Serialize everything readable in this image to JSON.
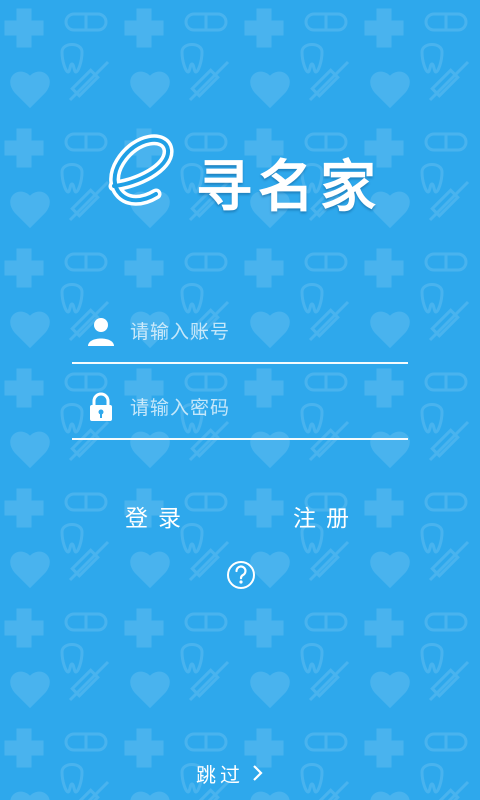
{
  "brand": {
    "letter": "e",
    "name": "寻名家"
  },
  "login_form": {
    "account_placeholder": "请输入账号",
    "password_placeholder": "请输入密码",
    "account_value": "",
    "password_value": ""
  },
  "actions": {
    "login_label": "登录",
    "register_label": "注册",
    "help_icon": "question-circle-icon"
  },
  "footer": {
    "skip_label": "跳过",
    "skip_icon": "chevron-right-icon"
  },
  "colors": {
    "background": "#2ea8ec",
    "foreground": "#ffffff",
    "logo_letter": "#1fa0e6"
  }
}
